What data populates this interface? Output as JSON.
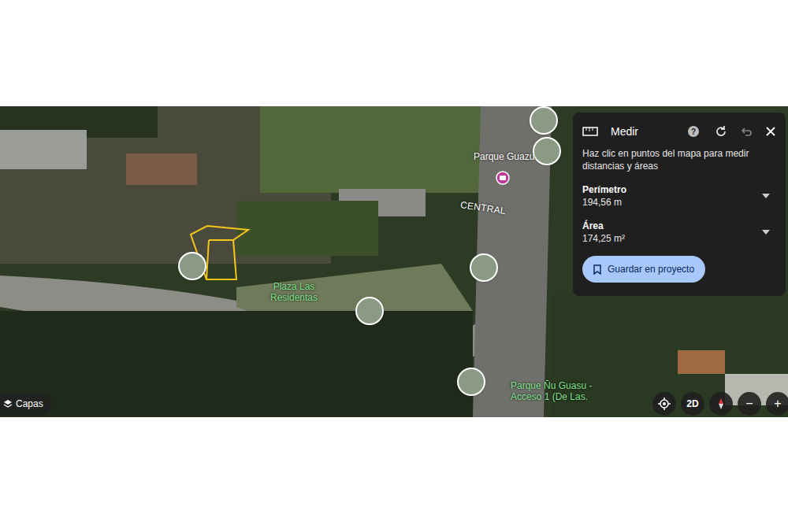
{
  "map": {
    "labels": [
      {
        "text": "Parque Guazu",
        "kind": "place"
      },
      {
        "text": "CENTRAL",
        "kind": "region"
      },
      {
        "text": "Plaza Las Residentas",
        "kind": "park"
      },
      {
        "text": "Parque Ñu Guasu - Acceso 1 (De Las.",
        "kind": "park"
      }
    ]
  },
  "measure_panel": {
    "title": "Medir",
    "help": "?",
    "instructions": "Haz clic en puntos del mapa para medir distancias y áreas",
    "measurements": [
      {
        "label": "Perímetro",
        "value": "194,56 m"
      },
      {
        "label": "Área",
        "value": "174,25 m²"
      }
    ],
    "save_button": "Guardar en proyecto"
  },
  "controls": {
    "layers": "Capas",
    "view_mode": "2D",
    "zoom_out": "−",
    "zoom_in": "+"
  }
}
